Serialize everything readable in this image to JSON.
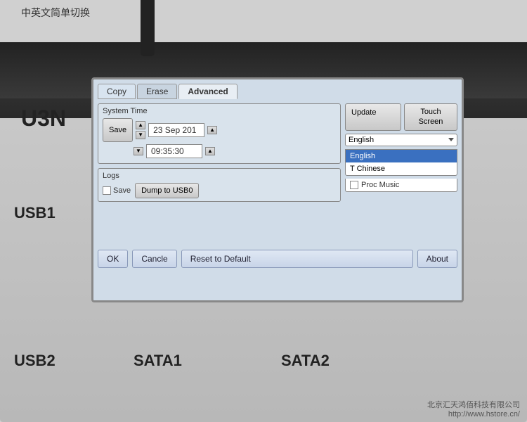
{
  "annotation": {
    "top_text": "中英文简单切换"
  },
  "device": {
    "model": "U3N",
    "usb1_label": "USB1",
    "usb2_label": "USB2",
    "sata1_label": "SATA1",
    "sata2_label": "SATA2"
  },
  "company": {
    "name": "北京汇天鸿佰科技有限公司",
    "url": "http://www.hstore.cn/"
  },
  "screen": {
    "tabs": [
      {
        "id": "copy",
        "label": "Copy"
      },
      {
        "id": "erase",
        "label": "Erase"
      },
      {
        "id": "advanced",
        "label": "Advanced",
        "active": true
      }
    ],
    "system_time": {
      "group_label": "System Time",
      "save_label": "Save",
      "date_value": "23 Sep 201",
      "time_value": "09:35:30"
    },
    "logs": {
      "group_label": "Logs",
      "save_label": "Save",
      "dump_label": "Dump to USB0"
    },
    "right_panel": {
      "update_label": "Update",
      "touch_screen_label": "Touch\nScreen",
      "language_selected": "English",
      "dropdown_options": [
        {
          "label": "English",
          "selected": true
        },
        {
          "label": "T Chinese",
          "selected": false
        }
      ],
      "proc_music_label": "Proc Music"
    },
    "bottom_buttons": {
      "ok_label": "OK",
      "cancel_label": "Cancle",
      "reset_label": "Reset to Default",
      "about_label": "About"
    }
  }
}
